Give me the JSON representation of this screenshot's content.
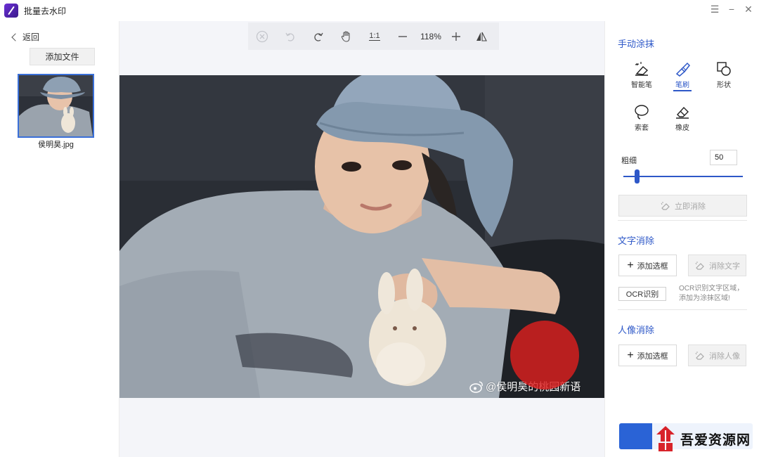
{
  "app": {
    "title": "批量去水印"
  },
  "window": {
    "menu_icon": "menu-icon",
    "minimize_icon": "minimize-icon",
    "close_icon": "close-icon"
  },
  "left": {
    "back_label": "返回",
    "add_file_label": "添加文件",
    "files": [
      {
        "name": "侯明昊.jpg",
        "selected": true
      }
    ]
  },
  "toolbar": {
    "zoom_label": "118%",
    "one_to_one": "1:1",
    "icons": [
      "clear-icon",
      "undo-icon",
      "redo-icon",
      "hand-icon",
      "actual-size-icon",
      "zoom-out-icon",
      "zoom-in-icon",
      "flip-icon"
    ]
  },
  "image": {
    "watermark_text": "@侯明昊的桃园新语"
  },
  "right": {
    "manual_title": "手动涂抹",
    "tools": [
      {
        "label": "智能笔",
        "icon": "smart-pen-icon",
        "active": false
      },
      {
        "label": "笔刷",
        "icon": "brush-icon",
        "active": true
      },
      {
        "label": "形状",
        "icon": "shape-icon",
        "active": false
      },
      {
        "label": "索套",
        "icon": "lasso-icon",
        "active": false
      },
      {
        "label": "橡皮",
        "icon": "eraser-icon",
        "active": false
      }
    ],
    "size_label": "粗细",
    "size_value": "50",
    "slider_value": 50,
    "apply_label": "立即消除",
    "text_title": "文字消除",
    "add_box_label": "添加选框",
    "remove_text_label": "消除文字",
    "ocr_label": "OCR识别",
    "ocr_hint": "OCR识别文字区域，添加为涂抹区域!",
    "portrait_title": "人像消除",
    "add_box_label_2": "添加选框",
    "remove_portrait_label": "消除人像"
  },
  "badge": {
    "site_name": "吾爱资源网"
  },
  "colors": {
    "accent": "#2e58c8",
    "primary_button": "#2a63d6",
    "brush": "#dc1e1e"
  }
}
